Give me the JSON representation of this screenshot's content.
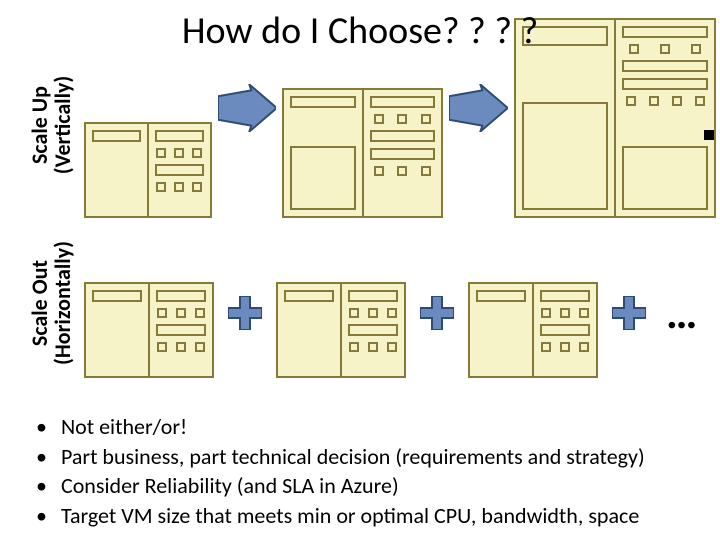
{
  "title": "How do I Choose? ? ? ?",
  "axes": {
    "up": {
      "line1": "Scale Up",
      "line2": "(Vertically)"
    },
    "out": {
      "line1": "Scale Out",
      "line2": "(Horizontally)"
    }
  },
  "ellipsis": "…",
  "bullets": [
    "Not either/or!",
    "Part business, part technical decision (requirements and strategy)",
    "Consider Reliability (and SLA in Azure)",
    "Target VM size that meets min or optimal CPU, bandwidth, space"
  ],
  "colors": {
    "server_fill": "#f6f3c8",
    "server_border": "#867a3a",
    "arrow_fill": "#6b8bbf",
    "arrow_stroke": "#2f4a73",
    "plus_fill": "#6b8bbf",
    "plus_stroke": "#2f4a73"
  }
}
